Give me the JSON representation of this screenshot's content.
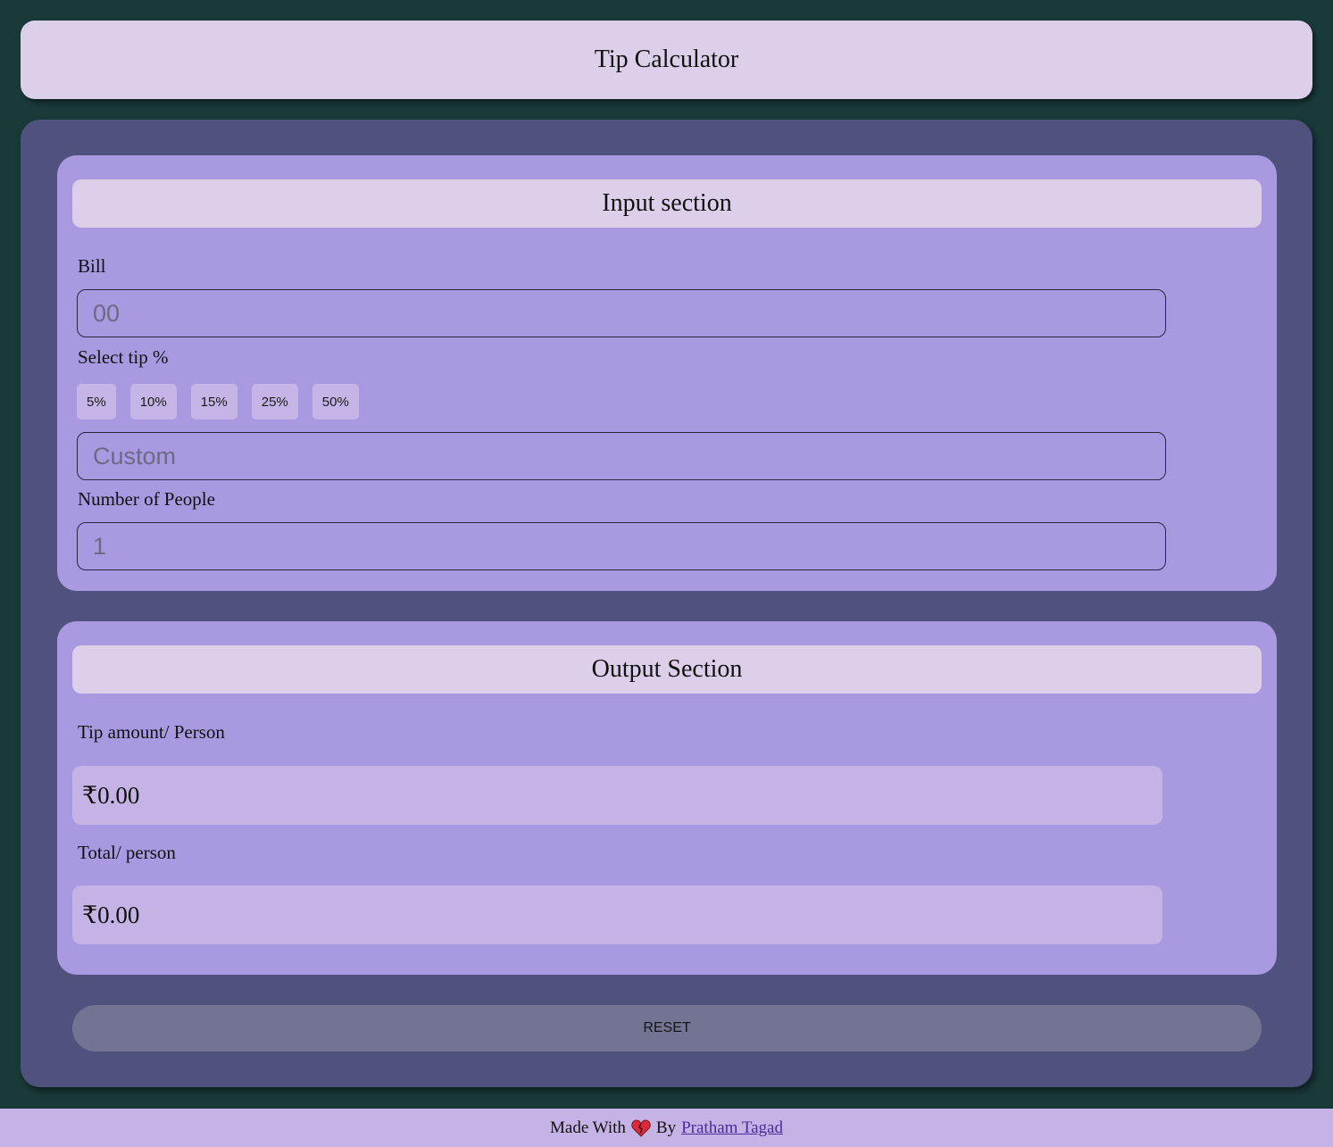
{
  "header": {
    "title": "Tip Calculator"
  },
  "input_section": {
    "title": "Input section",
    "bill_label": "Bill",
    "bill_placeholder": "00",
    "tip_label": "Select tip %",
    "tip_options": [
      "5%",
      "10%",
      "15%",
      "25%",
      "50%"
    ],
    "custom_placeholder": "Custom",
    "people_label": "Number of People",
    "people_placeholder": "1"
  },
  "output_section": {
    "title": "Output Section",
    "tip_label": "Tip amount/ Person",
    "tip_value": "₹0.00",
    "total_label": "Total/ person",
    "total_value": "₹0.00"
  },
  "reset_label": "RESET",
  "footer": {
    "made_with": "Made With",
    "icon": "heart-icon",
    "by": "By",
    "author": "Pratham Tagad"
  },
  "colors": {
    "background": "#1a3a3a",
    "main_panel": "#4f527c",
    "card": "#a899e0",
    "title_bar": "#dccfea",
    "result_box": "#c5b3e6",
    "reset_button": "#737394"
  }
}
